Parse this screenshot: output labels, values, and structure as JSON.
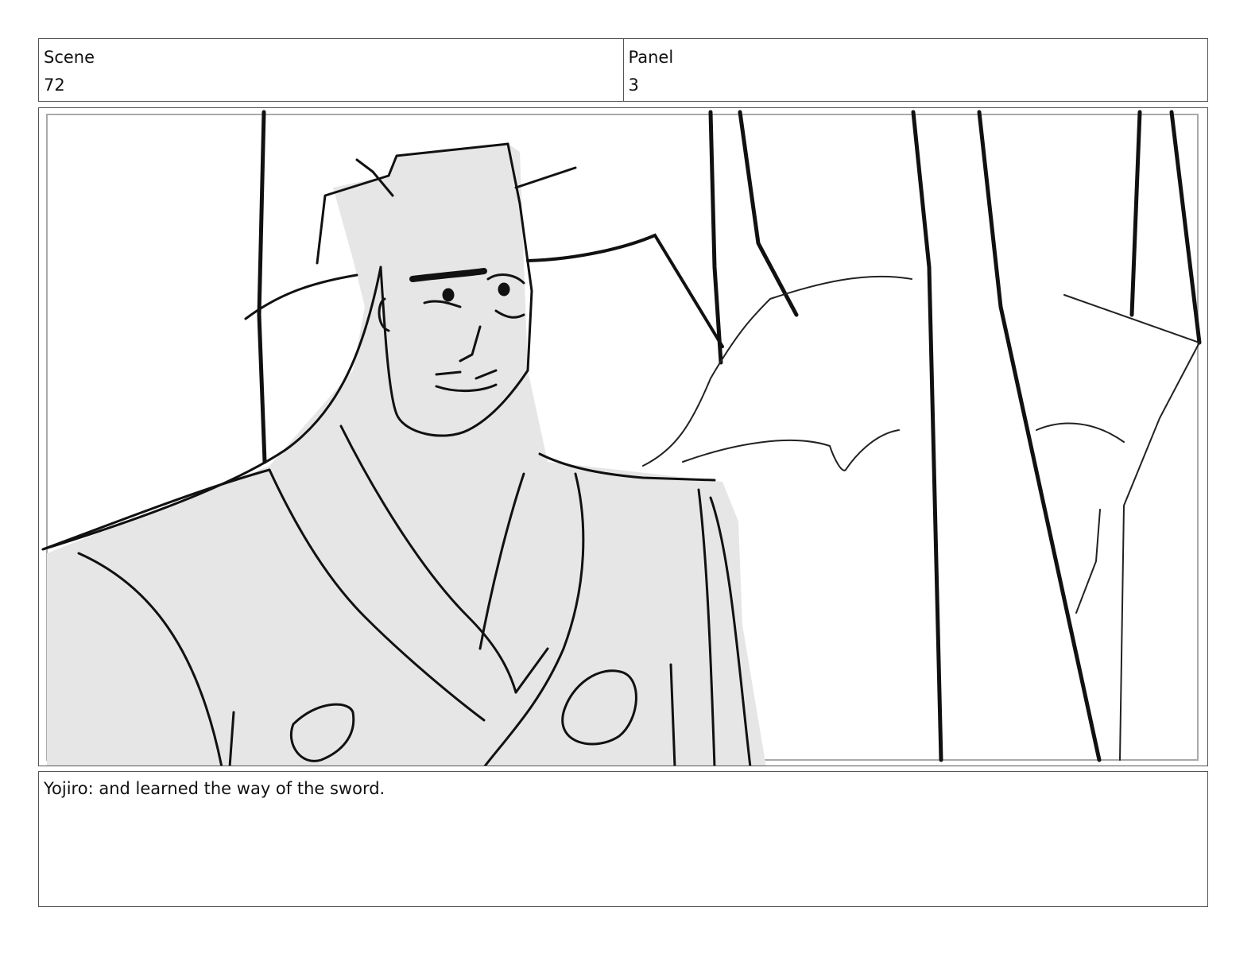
{
  "header": {
    "scene_label": "Scene",
    "scene_value": "72",
    "panel_label": "Panel",
    "panel_value": "3"
  },
  "frame": {
    "illustration": "storyboard-sketch-samurai-in-bamboo-forest"
  },
  "notes": {
    "dialogue": "Yojiro: and learned the way of the sword."
  }
}
